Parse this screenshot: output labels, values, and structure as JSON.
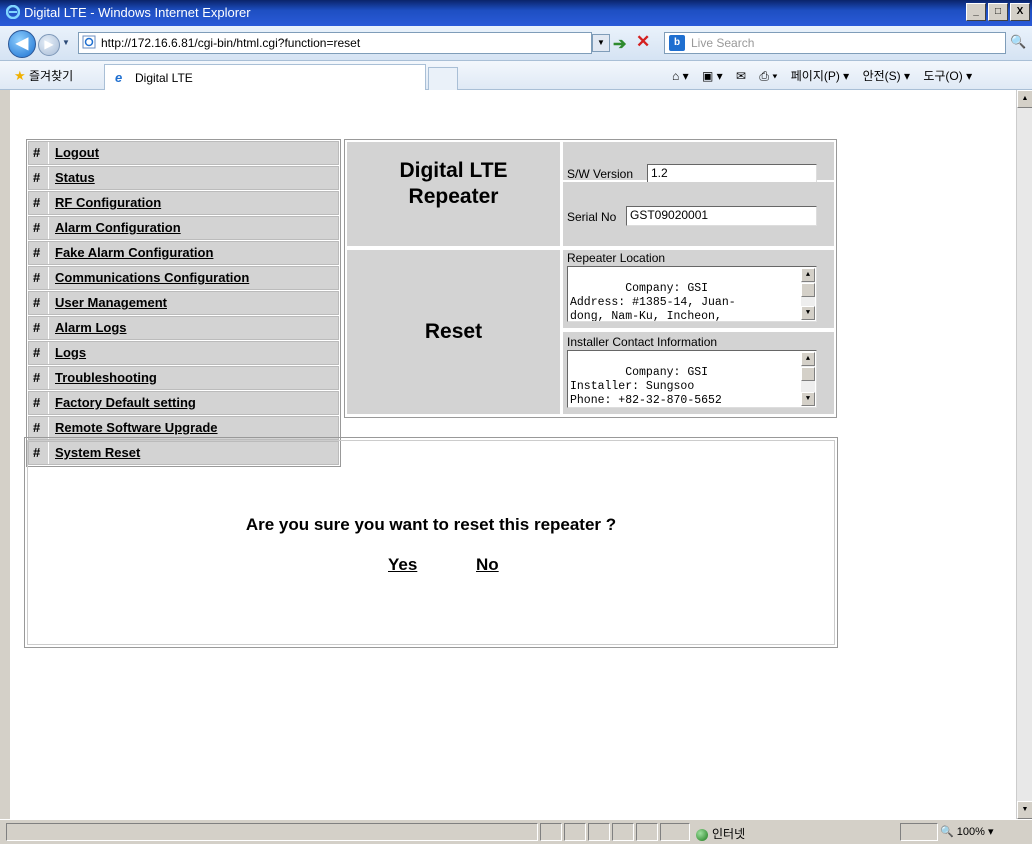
{
  "window": {
    "title": "Digital LTE - Windows Internet Explorer",
    "controls": [
      "_",
      "□",
      "X"
    ]
  },
  "navbar": {
    "url": "http://172.16.6.81/cgi-bin/html.cgi?function=reset",
    "search_placeholder": "Live Search"
  },
  "favbar": {
    "favorites_label": "즐겨찾기",
    "tab_title": "Digital LTE",
    "commands": [
      "페이지(P) ▾",
      "안전(S) ▾",
      "도구(O) ▾"
    ]
  },
  "menu": {
    "hash": "#",
    "items": [
      "Logout",
      "Status",
      "RF Configuration",
      "Alarm Configuration",
      "Fake Alarm Configuration",
      "Communications Configuration",
      "User Management",
      "Alarm Logs",
      "Logs",
      "Troubleshooting",
      "Factory Default setting",
      "Remote Software Upgrade",
      "System Reset"
    ]
  },
  "header": {
    "product_line1": "Digital LTE",
    "product_line2": "Repeater",
    "page_title": "Reset",
    "sw_version_label": "S/W Version",
    "sw_version_value": "1.2",
    "serial_label": "Serial No",
    "serial_value": "GST09020001",
    "location_label": "Repeater Location",
    "location_text": "Company: GSI\nAddress: #1385-14, Juan-\ndong, Nam-Ku, Incheon,",
    "installer_label": "Installer Contact Information",
    "installer_text": "Company: GSI\nInstaller: Sungsoo\nPhone: +82-32-870-5652"
  },
  "dialog": {
    "question": "Are you sure you want to reset this repeater ?",
    "yes": "Yes",
    "no": "No"
  },
  "statusbar": {
    "zone": "인터넷",
    "zoom": "100%"
  }
}
